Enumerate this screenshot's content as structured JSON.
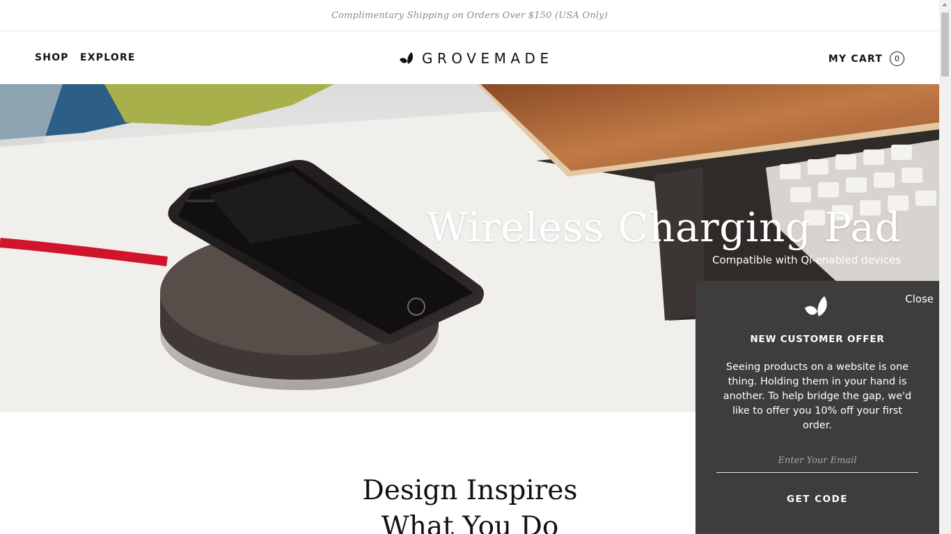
{
  "promo": {
    "text": "Complimentary Shipping on Orders Over $150 (USA Only)"
  },
  "nav": {
    "shop": "SHOP",
    "explore": "EXPLORE"
  },
  "logo": {
    "text": "GROVEMADE",
    "icon": "leaf-icon"
  },
  "cart": {
    "label": "MY CART",
    "count": "0"
  },
  "hero": {
    "title": "Wireless Charging Pad",
    "subtitle": "Compatible with Qi-enabled devices"
  },
  "section": {
    "title_line1": "Design Inspires",
    "title_line2": "What You Do"
  },
  "popup": {
    "close_label": "Close",
    "icon": "leaf-icon",
    "heading": "NEW CUSTOMER OFFER",
    "body": "Seeing products on a website is one thing. Holding them in your hand is another. To help bridge the gap, we'd like to offer you 10% off your first order.",
    "email_placeholder": "Enter Your Email",
    "email_value": "",
    "cta_label": "GET CODE"
  },
  "colors": {
    "popup_bg": "#3d3d3d",
    "text_dark": "#111111",
    "promo_text": "#8a8a8a",
    "cable_red": "#d2142a",
    "wood": "#b06a3b"
  }
}
